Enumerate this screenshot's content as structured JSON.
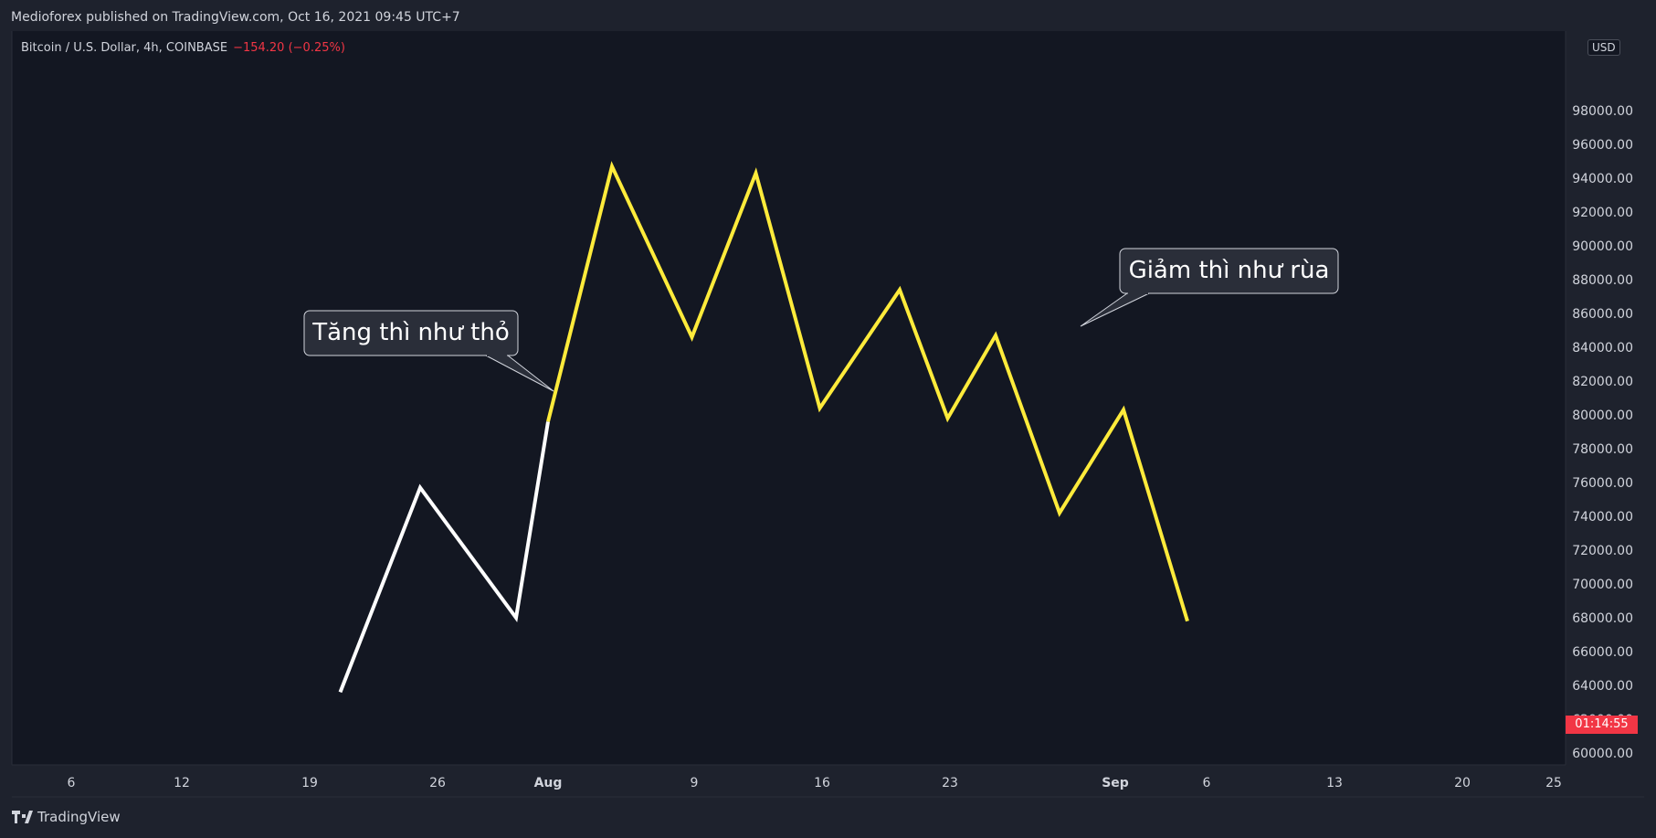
{
  "publisher_line": "Medioforex published on TradingView.com, Oct 16, 2021 09:45 UTC+7",
  "legend": {
    "symbol": "Bitcoin / U.S. Dollar, 4h, COINBASE",
    "change": "−154.20 (−0.25%)"
  },
  "currency": "USD",
  "countdown": "01:14:55",
  "brand": "TradingView",
  "colors": {
    "background": "#131722",
    "frame": "#1e222d",
    "white_line": "#ffffff",
    "yellow_line": "#ffeb3b",
    "countdown_bg": "#f23645",
    "axis_text": "#d1d4dc"
  },
  "chart_data": {
    "type": "line",
    "title": "",
    "xlabel": "",
    "ylabel": "",
    "x_ticks": [
      "6",
      "12",
      "19",
      "26",
      "Aug",
      "9",
      "16",
      "23",
      "Sep",
      "6",
      "13",
      "20",
      "25"
    ],
    "y_ticks": [
      "60000.00",
      "62000.00",
      "64000.00",
      "66000.00",
      "68000.00",
      "70000.00",
      "72000.00",
      "74000.00",
      "76000.00",
      "78000.00",
      "80000.00",
      "82000.00",
      "84000.00",
      "86000.00",
      "88000.00",
      "90000.00",
      "92000.00",
      "94000.00",
      "96000.00",
      "98000.00"
    ],
    "ylim": [
      60000,
      98000
    ],
    "grid": false,
    "series": [
      {
        "color": "#ffffff",
        "points": [
          {
            "date": "2021-07-19",
            "value": 63600
          },
          {
            "date": "2021-07-24",
            "value": 75700
          },
          {
            "date": "2021-07-30",
            "value": 68000
          },
          {
            "date": "2021-08-01",
            "value": 79600
          }
        ]
      },
      {
        "color": "#ffeb3b",
        "points": [
          {
            "date": "2021-08-05",
            "value": 94700
          },
          {
            "date": "2021-08-10",
            "value": 84600
          },
          {
            "date": "2021-08-14",
            "value": 94300
          },
          {
            "date": "2021-08-18",
            "value": 80400
          },
          {
            "date": "2021-08-23",
            "value": 87400
          },
          {
            "date": "2021-08-26",
            "value": 79800
          },
          {
            "date": "2021-08-29",
            "value": 84700
          },
          {
            "date": "2021-09-02",
            "value": 74200
          },
          {
            "date": "2021-09-06",
            "value": 80300
          },
          {
            "date": "2021-09-10",
            "value": 67800
          }
        ]
      }
    ],
    "annotations": [
      {
        "text": "Tăng thì như thỏ",
        "date": "2021-07-31",
        "value": 79600
      },
      {
        "text": "Giảm thì như rùa",
        "date": "2021-08-29",
        "value": 83000
      }
    ]
  }
}
